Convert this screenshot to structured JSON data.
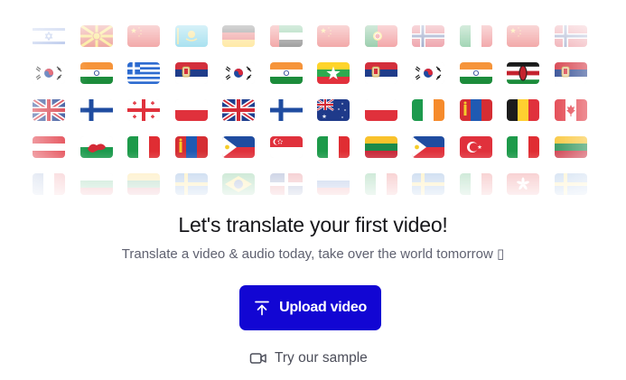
{
  "hero": {
    "title": "Let's translate your first video!",
    "subtitle": "Translate a video & audio today, take over the world tomorrow ▯"
  },
  "actions": {
    "upload_label": "Upload video",
    "sample_label": "Try our sample"
  },
  "colors": {
    "primary": "#1206d3",
    "title_text": "#16161a",
    "muted_text": "#5f6170"
  },
  "flags": [
    [
      "israel",
      "north-macedonia",
      "china",
      "kazakhstan",
      "germany",
      "uae",
      "china",
      "portugal",
      "norway",
      "italy",
      "china",
      "norway"
    ],
    [
      "south-korea",
      "india",
      "greece",
      "serbia",
      "south-korea",
      "india",
      "myanmar",
      "serbia",
      "south-korea",
      "india",
      "kenya",
      "serbia"
    ],
    [
      "united-kingdom",
      "finland",
      "georgia",
      "poland",
      "united-kingdom",
      "finland",
      "australia",
      "poland",
      "ireland",
      "mongolia",
      "belgium",
      "canada"
    ],
    [
      "austria",
      "wales",
      "italy",
      "mongolia",
      "philippines",
      "singapore",
      "italy",
      "lithuania",
      "philippines",
      "turkey",
      "italy",
      "lithuania"
    ],
    [
      "france",
      "bulgaria",
      "lithuania",
      "sweden",
      "brazil",
      "dominican-republic",
      "russia",
      "italy",
      "sweden",
      "italy",
      "hong-kong",
      "sweden"
    ]
  ]
}
